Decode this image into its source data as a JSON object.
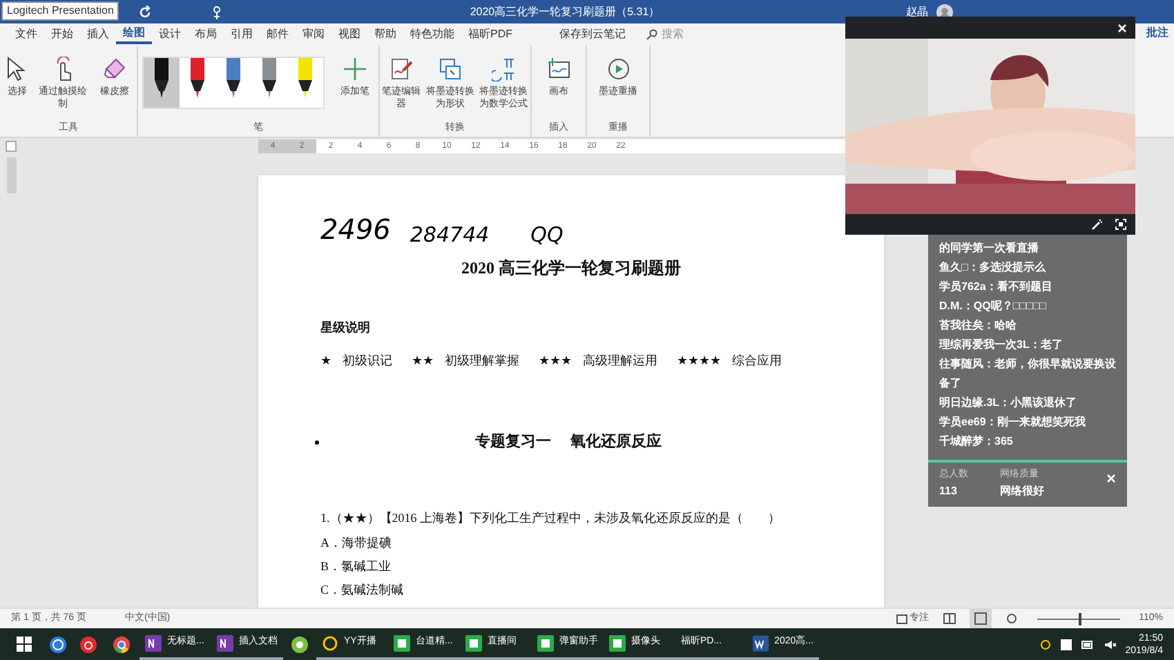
{
  "tooltip": "Logitech Presentation",
  "window": {
    "title": "2020高三化学一轮复习刷题册（5.31）",
    "user": "赵晶"
  },
  "menu_tabs": [
    {
      "label": "文件",
      "selected": false
    },
    {
      "label": "开始",
      "selected": false
    },
    {
      "label": "插入",
      "selected": false
    },
    {
      "label": "绘图",
      "selected": true
    },
    {
      "label": "设计",
      "selected": false
    },
    {
      "label": "布局",
      "selected": false
    },
    {
      "label": "引用",
      "selected": false
    },
    {
      "label": "邮件",
      "selected": false
    },
    {
      "label": "审阅",
      "selected": false
    },
    {
      "label": "视图",
      "selected": false
    },
    {
      "label": "帮助",
      "selected": false
    },
    {
      "label": "特色功能",
      "selected": false
    },
    {
      "label": "福昕PDF",
      "selected": false
    },
    {
      "label": "保存到云笔记",
      "selected": false
    }
  ],
  "search": {
    "placeholder": "搜索"
  },
  "comment_button": "批注",
  "ribbon_groups": [
    {
      "label": "工具",
      "buttons": [
        {
          "kind": "select",
          "label": "选择"
        },
        {
          "kind": "touch",
          "label": "通过触摸绘制"
        },
        {
          "kind": "eraser",
          "label": "橡皮擦"
        }
      ]
    },
    {
      "label": "笔",
      "pens": [
        {
          "color": "#111111",
          "selected": true
        },
        {
          "color": "#e0202a",
          "selected": false
        },
        {
          "color": "#4a7fc0",
          "selected": false
        },
        {
          "color": "#8a8f94",
          "selected": false
        },
        {
          "color": "#f5e400",
          "selected": false
        }
      ],
      "buttons": [
        {
          "kind": "add-pen",
          "label": "添加笔"
        }
      ]
    },
    {
      "label": "转换",
      "buttons": [
        {
          "kind": "ink-editor",
          "label": "笔迹编辑器"
        },
        {
          "kind": "ink-to-shape",
          "label": "将墨迹转换为形状"
        },
        {
          "kind": "ink-to-math",
          "label": "将墨迹转换为数学公式"
        }
      ]
    },
    {
      "label": "插入",
      "buttons": [
        {
          "kind": "canvas",
          "label": "画布"
        }
      ]
    },
    {
      "label": "重播",
      "buttons": [
        {
          "kind": "replay",
          "label": "墨迹重播"
        }
      ]
    }
  ],
  "ruler_labels": [
    "4",
    "2",
    "2",
    "4",
    "6",
    "8",
    "10",
    "12",
    "14",
    "16",
    "18",
    "20",
    "22"
  ],
  "document": {
    "ink_note": [
      "2496",
      "284744",
      "QQ"
    ],
    "title": "2020 高三化学一轮复习刷题册",
    "legend_heading": "星级说明",
    "legend": [
      {
        "stars": "★",
        "text": "初级识记"
      },
      {
        "stars": "★★",
        "text": "初级理解掌握"
      },
      {
        "stars": "★★★",
        "text": "高级理解运用"
      },
      {
        "stars": "★★★★",
        "text": "综合应用"
      }
    ],
    "section_heading": "专题复习一　 氧化还原反应",
    "question": "1.（★★）【2016 上海卷】下列化工生产过程中，未涉及氧化还原反应的是（　　）",
    "options": [
      "A．海带提碘",
      "B．氯碱工业",
      "C．氨碱法制碱"
    ]
  },
  "chat": {
    "messages": [
      "的同学第一次看直播",
      "鱼久□：多选没提示么",
      "学员762a：看不到题目",
      "D.M.：QQ呢？□□□□□",
      "苔我往矣：哈哈",
      "理综再爱我一次3L：老了",
      "往事随风：老师，你很早就说要换设备了",
      "明日边缘.3L：小黑该退休了",
      "学员ee69：刚一来就想笑死我",
      "千城醉梦：365"
    ],
    "total_label": "总人数",
    "total": "113",
    "network_label": "网络质量",
    "network": "网络很好"
  },
  "status_bar": {
    "page": "第 1 页，共 76 页",
    "language": "中文(中国)",
    "focus": "专注",
    "zoom": "110%",
    "zoom_level": {
      "level": 0.5
    }
  },
  "taskbar": {
    "items": [
      {
        "kind": "start"
      },
      {
        "kind": "k-app"
      },
      {
        "kind": "music-app"
      },
      {
        "kind": "chrome"
      },
      {
        "kind": "onenote",
        "label": "无标题..."
      },
      {
        "kind": "onenote",
        "label": "插入文档"
      },
      {
        "kind": "round-app"
      },
      {
        "kind": "yy",
        "label": "YY开播"
      },
      {
        "kind": "document-app",
        "label": "台道精..."
      },
      {
        "kind": "document-app",
        "label": "直播间"
      },
      {
        "kind": "document-app",
        "label": "弹窗助手"
      },
      {
        "kind": "document-app",
        "label": "摄像头"
      },
      {
        "kind": "plain",
        "label": "福昕PD..."
      },
      {
        "kind": "word",
        "label": "2020高..."
      }
    ],
    "time": "21:50",
    "date": "2019/8/4"
  }
}
